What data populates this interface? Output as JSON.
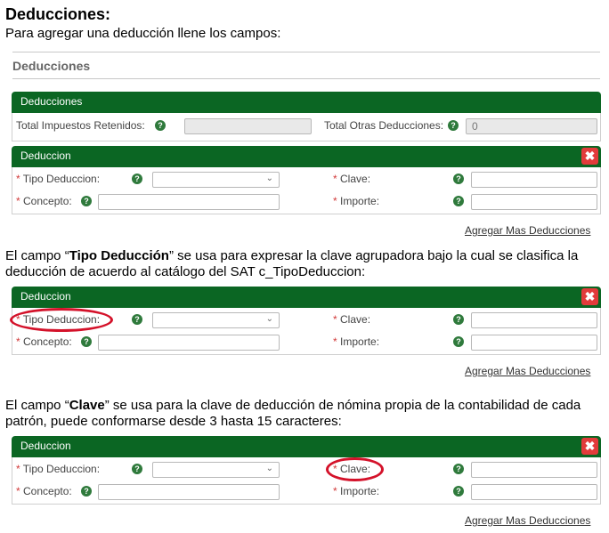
{
  "heading": "Deducciones:",
  "intro": "Para agregar una deducción llene los campos:",
  "section_title": "Deducciones",
  "summary_panel": {
    "bar_title": "Deducciones",
    "total_retenidos_label": "Total Impuestos Retenidos:",
    "total_otras_label": "Total Otras Deducciones:",
    "total_otras_value": "0"
  },
  "deduccion_form": {
    "bar_title": "Deduccion",
    "close_glyph": "✖",
    "required_mark": "*",
    "tipo_label": "Tipo Deduccion:",
    "clave_label": "Clave:",
    "concepto_label": "Concepto:",
    "importe_label": "Importe:",
    "help_glyph": "?",
    "add_more_link": "Agregar Mas Deducciones"
  },
  "para_tipo": {
    "p1": "El campo “",
    "bold": "Tipo Deducción",
    "p2": "” se usa para expresar la clave agrupadora bajo la cual se clasifica la deducción de acuerdo al catálogo del SAT c_TipoDeduccion:"
  },
  "para_clave": {
    "p1": "El campo “",
    "bold": "Clave",
    "p2": "” se usa para la clave de deducción de nómina propia de la contabilidad de cada patrón, puede conformarse desde 3 hasta 15 caracteres:"
  },
  "colors": {
    "bar_green": "#0b6623",
    "help_green": "#2f7a3c",
    "close_red": "#e23b3b",
    "highlight_red": "#d4122a"
  }
}
